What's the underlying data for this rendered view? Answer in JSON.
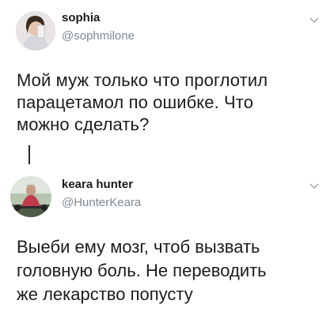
{
  "tweets": [
    {
      "name": "sophia",
      "handle": "@sophmilone",
      "text_lines": [
        "Мой муж только что проглотил",
        "парацетамол по ошибке. Что",
        "можно сделать?"
      ]
    },
    {
      "name": "keara hunter",
      "handle": "@HunterKeara",
      "text_lines": [
        "Выеби ему мозг, чтоб вызвать",
        "головную боль. Не переводить",
        "же лекарство попусту"
      ]
    }
  ],
  "icons": {
    "more": "chevron-down-icon",
    "avatar": "avatar"
  },
  "colors": {
    "handle": "#7e8a94",
    "text": "#1c1c1c",
    "thread_line": "#2a2a2a"
  }
}
